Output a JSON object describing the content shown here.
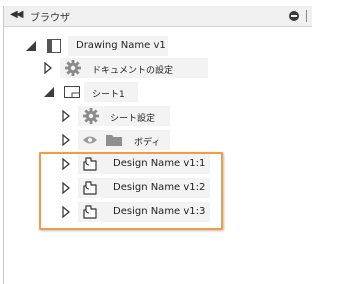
{
  "header": {
    "collapse_glyph": "◀◀",
    "title": "ブラウザ",
    "pin_icon": "pin-icon",
    "grip_icon": "panel-grip-icon"
  },
  "tree": {
    "root": {
      "label": "Drawing Name v1",
      "icon": "drawing-icon",
      "expanded": true
    },
    "document_settings": {
      "label": "ドキュメントの設定",
      "icon": "gear-icon",
      "expanded": false
    },
    "sheet": {
      "label": "シート1",
      "icon": "sheet-icon",
      "expanded": true
    },
    "sheet_settings": {
      "label": "シート設定",
      "icon": "gear-icon",
      "expanded": false
    },
    "bodies": {
      "label": "ボディ",
      "icon": "folder-icon",
      "visibility_icon": "eye-icon",
      "expanded": false
    },
    "designs": [
      {
        "label": "Design Name v1:1",
        "icon": "component-icon",
        "expanded": false
      },
      {
        "label": "Design Name v1:2",
        "icon": "component-icon",
        "expanded": false
      },
      {
        "label": "Design Name v1:3",
        "icon": "component-icon",
        "expanded": false
      }
    ]
  },
  "colors": {
    "highlight_border": "#f29a4a",
    "row_background": "#f3f3f3",
    "header_background": "#f0f0f0"
  }
}
